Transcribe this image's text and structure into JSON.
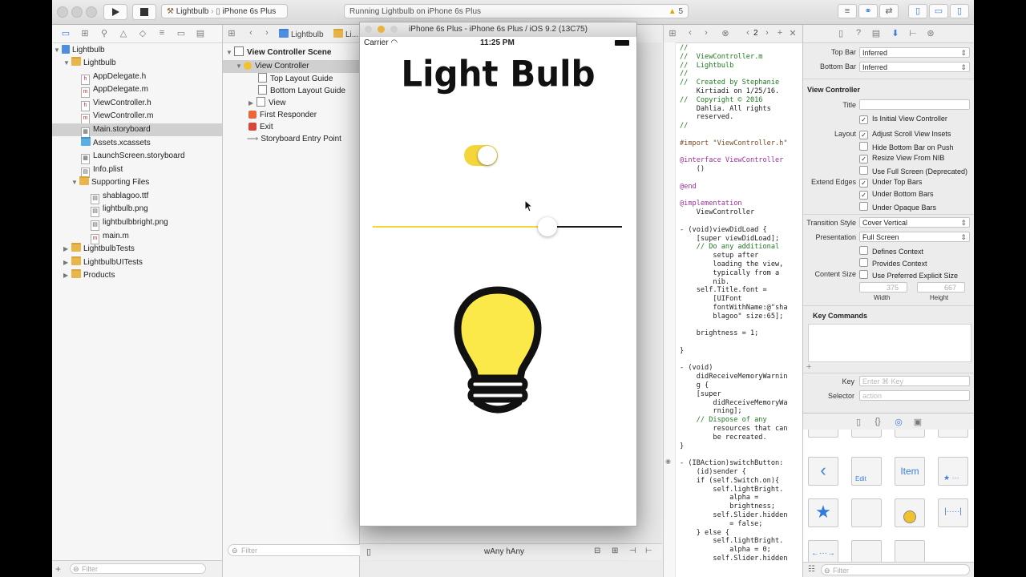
{
  "toolbar": {
    "scheme": "Lightbulb",
    "device": "iPhone 6s Plus",
    "status": "Running Lightbulb on iPhone 6s Plus",
    "warning_count": "5"
  },
  "navigator": {
    "items": [
      {
        "label": "Lightbulb"
      },
      {
        "label": "Lightbulb"
      },
      {
        "label": "AppDelegate.h"
      },
      {
        "label": "AppDelegate.m"
      },
      {
        "label": "ViewController.h"
      },
      {
        "label": "ViewController.m"
      },
      {
        "label": "Main.storyboard"
      },
      {
        "label": "Assets.xcassets"
      },
      {
        "label": "LaunchScreen.storyboard"
      },
      {
        "label": "Info.plist"
      },
      {
        "label": "Supporting Files"
      },
      {
        "label": "shablagoo.ttf"
      },
      {
        "label": "lightbulb.png"
      },
      {
        "label": "lightbulbbright.png"
      },
      {
        "label": "main.m"
      },
      {
        "label": "LightbulbTests"
      },
      {
        "label": "LightbulbUITests"
      },
      {
        "label": "Products"
      }
    ],
    "filter_placeholder": "Filter"
  },
  "scene": {
    "breadcrumb": "Lightbulb",
    "breadcrumb2": "Li...",
    "title": "View Controller Scene",
    "items": [
      {
        "label": "View Controller"
      },
      {
        "label": "Top Layout Guide"
      },
      {
        "label": "Bottom Layout Guide"
      },
      {
        "label": "View"
      },
      {
        "label": "First Responder"
      },
      {
        "label": "Exit"
      },
      {
        "label": "Storyboard Entry Point"
      }
    ],
    "filter_placeholder": "Filter"
  },
  "canvas": {
    "size_w": "wAny",
    "size_h": "hAny"
  },
  "simulator": {
    "title": "iPhone 6s Plus - iPhone 6s Plus / iOS 9.2 (13C75)",
    "carrier": "Carrier",
    "time": "11:25 PM",
    "app_title": "Light Bulb",
    "switch_on": true,
    "slider_value": 0.7,
    "colors": {
      "accent": "#f4d63a",
      "bulb": "#fbe94a",
      "outline": "#111111"
    }
  },
  "code": {
    "page_indicator": "2",
    "lines": [
      "//",
      "//  ViewController.m",
      "//  Lightbulb",
      "//",
      "//  Created by Stephanie",
      "    Kirtiadi on 1/25/16.",
      "//  Copyright © 2016",
      "    Dahlia. All rights",
      "    reserved.",
      "//",
      "",
      "#import \"ViewController.h\"",
      "",
      "@interface ViewController",
      "    ()",
      "",
      "@end",
      "",
      "@implementation",
      "    ViewController",
      "",
      "- (void)viewDidLoad {",
      "    [super viewDidLoad];",
      "    // Do any additional",
      "        setup after",
      "        loading the view,",
      "        typically from a",
      "        nib.",
      "    self.Title.font =",
      "        [UIFont",
      "        fontWithName:@\"sha",
      "        blagoo\" size:65];",
      "",
      "    brightness = 1;",
      "",
      "}",
      "",
      "- (void)",
      "    didReceiveMemoryWarnin",
      "    g {",
      "    [super",
      "        didReceiveMemoryWa",
      "        rning];",
      "    // Dispose of any",
      "        resources that can",
      "        be recreated.",
      "}",
      "",
      "- (IBAction)switchButton:",
      "    (id)sender {",
      "    if (self.Switch.on){",
      "        self.lightBright.",
      "            alpha =",
      "            brightness;",
      "        self.Slider.hidden",
      "            = false;",
      "    } else {",
      "        self.lightBright.",
      "            alpha = 0;",
      "        self.Slider.hidden"
    ]
  },
  "inspector": {
    "top_bar_label": "Top Bar",
    "top_bar_value": "Inferred",
    "bottom_bar_label": "Bottom Bar",
    "bottom_bar_value": "Inferred",
    "section_vc": "View Controller",
    "title_label": "Title",
    "initial_vc": "Is Initial View Controller",
    "layout_label": "Layout",
    "adjust_scroll": "Adjust Scroll View Insets",
    "hide_bottom": "Hide Bottom Bar on Push",
    "resize_nib": "Resize View From NIB",
    "full_screen": "Use Full Screen (Deprecated)",
    "extend_label": "Extend Edges",
    "under_top": "Under Top Bars",
    "under_bottom": "Under Bottom Bars",
    "under_opaque": "Under Opaque Bars",
    "transition_label": "Transition Style",
    "transition_value": "Cover Vertical",
    "presentation_label": "Presentation",
    "presentation_value": "Full Screen",
    "defines_context": "Defines Context",
    "provides_context": "Provides Context",
    "content_size_label": "Content Size",
    "preferred_size": "Use Preferred Explicit Size",
    "width_value": "375",
    "height_value": "667",
    "width_label": "Width",
    "height_label": "Height",
    "key_commands": "Key Commands",
    "key_label": "Key",
    "key_placeholder": "Enter ⌘ Key",
    "selector_label": "Selector",
    "selector_placeholder": "action",
    "library_item": "Item",
    "library_edit": "Edit",
    "filter_placeholder": "Filter"
  }
}
